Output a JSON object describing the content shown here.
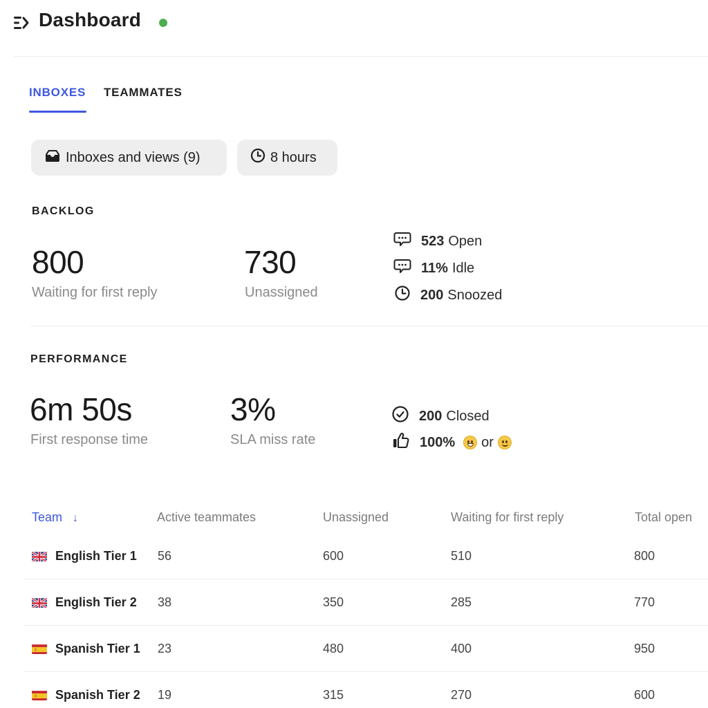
{
  "header": {
    "title": "Dashboard",
    "status": "online",
    "status_color": "#4caf50",
    "menu_icon": "collapse-menu-icon"
  },
  "tabs": [
    {
      "label": "INBOXES",
      "active": true
    },
    {
      "label": "TEAMMATES",
      "active": false
    }
  ],
  "accent_color": "#3e57e0",
  "filters": {
    "inboxes": {
      "label": "Inboxes and views (9)",
      "icon": "inbox-icon"
    },
    "time_range": {
      "label": "8 hours",
      "icon": "clock-icon"
    }
  },
  "backlog": {
    "title": "BACKLOG",
    "metrics": [
      {
        "value": "800",
        "label": "Waiting for first reply"
      },
      {
        "value": "730",
        "label": "Unassigned"
      }
    ],
    "side_stats": [
      {
        "icon": "chat-bubble-icon",
        "value": "523",
        "label": "Open"
      },
      {
        "icon": "chat-bubble-icon",
        "value": "11%",
        "label": "Idle"
      },
      {
        "icon": "clock-icon",
        "value": "200",
        "label": "Snoozed"
      }
    ]
  },
  "performance": {
    "title": "PERFORMANCE",
    "metrics": [
      {
        "value": "6m 50s",
        "label": "First response time"
      },
      {
        "value": "3%",
        "label": "SLA miss rate"
      }
    ],
    "side_stats": [
      {
        "icon": "check-circle-icon",
        "value": "200",
        "label": "Closed"
      },
      {
        "icon": "thumbs-up-icon",
        "value": "100%",
        "label": "or",
        "emojis": [
          "grinning-face",
          "slightly-smiling-face"
        ]
      }
    ]
  },
  "table": {
    "columns": [
      {
        "label": "Team",
        "sorted": "descending",
        "sort_icon": "arrow-down-icon"
      },
      {
        "label": "Active teammates"
      },
      {
        "label": "Unassigned"
      },
      {
        "label": "Waiting for first reply"
      },
      {
        "label": "Total open"
      }
    ],
    "rows": [
      {
        "flag": "uk",
        "team": "English Tier 1",
        "active": "56",
        "unassigned": "600",
        "waiting": "510",
        "total_open": "800"
      },
      {
        "flag": "uk",
        "team": "English Tier 2",
        "active": "38",
        "unassigned": "350",
        "waiting": "285",
        "total_open": "770"
      },
      {
        "flag": "es",
        "team": "Spanish Tier 1",
        "active": "23",
        "unassigned": "480",
        "waiting": "400",
        "total_open": "950"
      },
      {
        "flag": "es",
        "team": "Spanish Tier 2",
        "active": "19",
        "unassigned": "315",
        "waiting": "270",
        "total_open": "600"
      }
    ]
  }
}
